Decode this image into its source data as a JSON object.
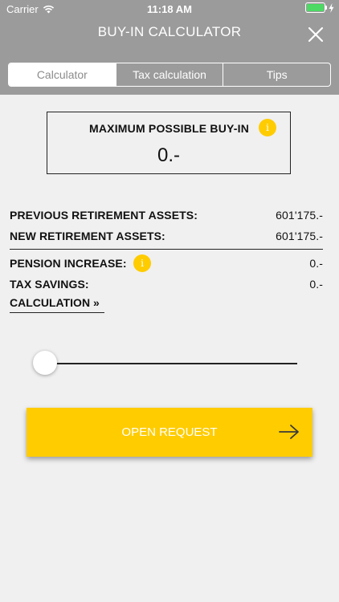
{
  "status": {
    "carrier": "Carrier",
    "time": "11:18 AM"
  },
  "header": {
    "title": "BUY-IN CALCULATOR"
  },
  "tabs": [
    {
      "label": "Calculator"
    },
    {
      "label": "Tax calculation"
    },
    {
      "label": "Tips"
    }
  ],
  "max_buyin": {
    "label": "MAXIMUM POSSIBLE BUY-IN",
    "value": "0.-",
    "info_glyph": "i"
  },
  "rows": {
    "previous": {
      "label": "PREVIOUS RETIREMENT ASSETS:",
      "value": "601'175.-"
    },
    "new": {
      "label": "NEW RETIREMENT ASSETS:",
      "value": "601'175.-"
    },
    "pension": {
      "label": "PENSION INCREASE:",
      "value": "0.-",
      "info_glyph": "i"
    },
    "tax": {
      "label": "TAX SAVINGS:",
      "value": "0.-"
    }
  },
  "calculation_link": "CALCULATION  »",
  "slider": {
    "value_fraction": 0.0
  },
  "open_request": {
    "label": "OPEN REQUEST"
  },
  "colors": {
    "accent": "#ffcc00",
    "header": "#9b9b9b",
    "background": "#f0f0f0",
    "battery": "#4cd964"
  }
}
